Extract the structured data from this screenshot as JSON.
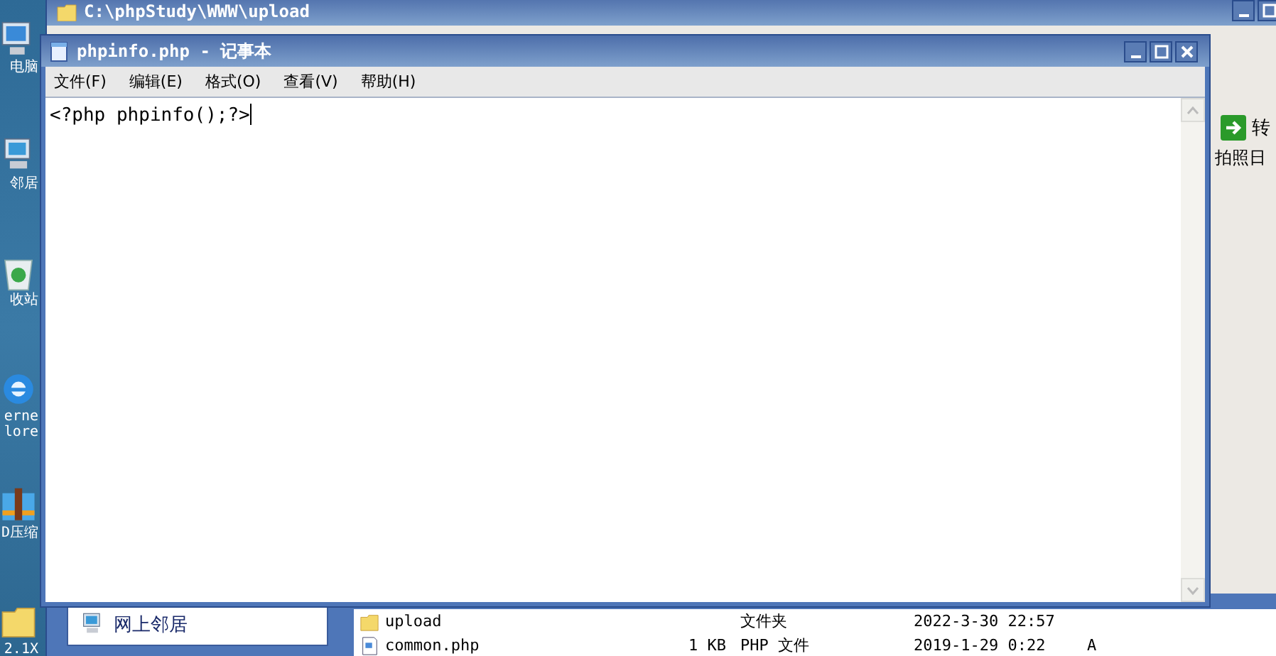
{
  "desktop_icons": [
    {
      "kind": "computer",
      "lines": [
        "电脑"
      ]
    },
    {
      "kind": "network",
      "lines": [
        "邻居"
      ]
    },
    {
      "kind": "recycle",
      "lines": [
        "收站"
      ]
    },
    {
      "kind": "browser",
      "lines": [
        "erne",
        "lore"
      ]
    },
    {
      "kind": "archive",
      "lines": [
        "D压缩"
      ]
    },
    {
      "kind": "folder",
      "lines": [
        "2.1X"
      ]
    }
  ],
  "explorer": {
    "title": "C:\\phpStudy\\WWW\\upload",
    "go_label": "转",
    "column_header": "拍照日",
    "sidebar_item": "网上邻居",
    "files": [
      {
        "kind": "folder",
        "name": "upload",
        "type": "文件夹",
        "date": "2022-3-30 22:57"
      },
      {
        "kind": "php",
        "name": "common.php",
        "size": "1 KB",
        "type": "PHP 文件",
        "date": "2019-1-29 0:22",
        "attr": "A"
      }
    ]
  },
  "notepad": {
    "title": "phpinfo.php - 记事本",
    "menu": [
      "文件(F)",
      "编辑(E)",
      "格式(O)",
      "查看(V)",
      "帮助(H)"
    ],
    "content": "<?php phpinfo();?>"
  }
}
